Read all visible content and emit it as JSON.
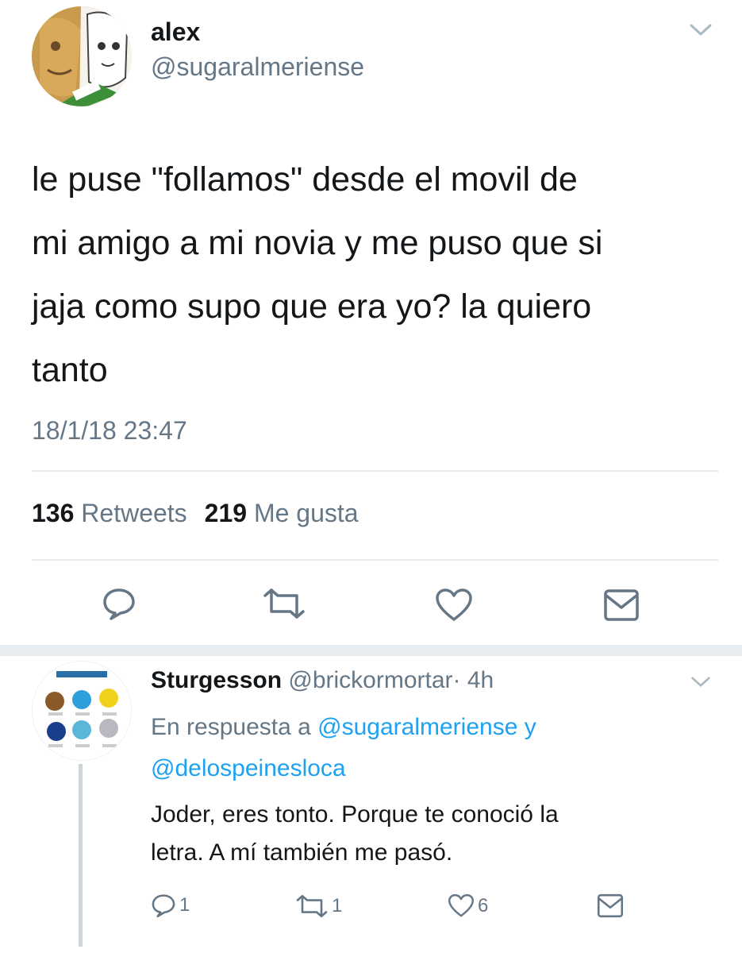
{
  "tweet": {
    "author_name": "alex",
    "author_handle": "@sugaralmeriense",
    "text_lines": [
      "le puse \"follamos\" desde el movil de",
      "mi amigo a mi novia y me puso que si",
      "jaja como supo que era yo? la quiero",
      "tanto"
    ],
    "timestamp": "18/1/18 23:47",
    "retweets_count": "136",
    "retweets_label": "Retweets",
    "likes_count": "219",
    "likes_label": "Me gusta",
    "icons": {
      "menu": "chevron-down-icon",
      "reply": "reply-icon",
      "retweet": "retweet-icon",
      "like": "heart-icon",
      "dm": "envelope-icon"
    }
  },
  "reply": {
    "author_name": "Sturgesson",
    "author_handle": "@brickormortar",
    "time": "· 4h",
    "reply_prefix": "En respuesta a",
    "mention_1": "@sugaralmeriense",
    "conjunction": "y",
    "mention_2": "@delospeinesloca",
    "text_lines": [
      "Joder, eres tonto. Porque te conoció la",
      "letra. A mí también me pasó."
    ],
    "reply_count": "1",
    "retweet_count": "1",
    "like_count": "6"
  },
  "colors": {
    "text": "#14171a",
    "secondary": "#657786",
    "link": "#1da1f2",
    "divider": "#e6ecf0"
  }
}
